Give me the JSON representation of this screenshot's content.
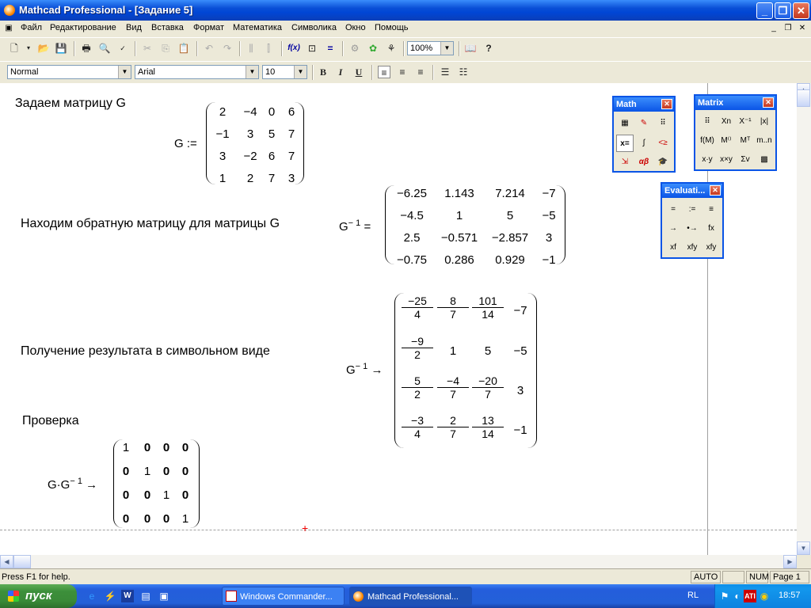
{
  "window": {
    "title": "Mathcad Professional - [Задание 5]"
  },
  "menu": [
    "Файл",
    "Редактирование",
    "Вид",
    "Вставка",
    "Формат",
    "Математика",
    "Символика",
    "Окно",
    "Помощь"
  ],
  "toolbar": {
    "zoom": "100%",
    "style": "Normal",
    "font": "Arial",
    "size": "10",
    "bold": "B",
    "italic": "I",
    "underline": "U"
  },
  "doc": {
    "label1": "Задаем матрицу G",
    "label2": "Находим обратную матрицу для матрицы G",
    "label3": "Получение результата в символьном виде",
    "label4": "Проверка",
    "def_lhs": "G :=",
    "inv_lhs": "G",
    "inv_sup": "− 1",
    "inv_eq": "=",
    "sym_lhs": "G",
    "sym_sup": "− 1",
    "sym_arrow": "→",
    "chk_lhs": "G·G",
    "chk_sup": "− 1",
    "chk_arrow": "→",
    "G": [
      [
        "2",
        "−4",
        "0",
        "6"
      ],
      [
        "−1",
        "3",
        "5",
        "7"
      ],
      [
        "3",
        "−2",
        "6",
        "7"
      ],
      [
        "1",
        "2",
        "7",
        "3"
      ]
    ],
    "Ginv": [
      [
        "−6.25",
        "1.143",
        "7.214",
        "−7"
      ],
      [
        "−4.5",
        "1",
        "5",
        "−5"
      ],
      [
        "2.5",
        "−0.571",
        "−2.857",
        "3"
      ],
      [
        "−0.75",
        "0.286",
        "0.929",
        "−1"
      ]
    ],
    "Gsym": [
      [
        {
          "n": "−25",
          "d": "4"
        },
        {
          "n": "8",
          "d": "7"
        },
        {
          "n": "101",
          "d": "14"
        },
        {
          "v": "−7"
        }
      ],
      [
        {
          "n": "−9",
          "d": "2"
        },
        {
          "v": "1"
        },
        {
          "v": "5"
        },
        {
          "v": "−5"
        }
      ],
      [
        {
          "n": "5",
          "d": "2"
        },
        {
          "n": "−4",
          "d": "7"
        },
        {
          "n": "−20",
          "d": "7"
        },
        {
          "v": "3"
        }
      ],
      [
        {
          "n": "−3",
          "d": "4"
        },
        {
          "n": "2",
          "d": "7"
        },
        {
          "n": "13",
          "d": "14"
        },
        {
          "v": "−1"
        }
      ]
    ],
    "I": [
      [
        "1",
        "0",
        "0",
        "0"
      ],
      [
        "0",
        "1",
        "0",
        "0"
      ],
      [
        "0",
        "0",
        "1",
        "0"
      ],
      [
        "0",
        "0",
        "0",
        "1"
      ]
    ]
  },
  "palettes": {
    "math": {
      "title": "Math"
    },
    "matrix": {
      "title": "Matrix"
    },
    "evaluation": {
      "title": "Evaluati...",
      "buttons": [
        "=",
        ":=",
        "≡",
        "→",
        "•→",
        "fx",
        "xf",
        "xfy",
        "xfy"
      ]
    }
  },
  "status": {
    "help": "Press F1 for help.",
    "mode": "AUTO",
    "num": "NUM",
    "page": "Page 1"
  },
  "taskbar": {
    "start": "пуск",
    "task1": "Windows Commander...",
    "task2": "Mathcad Professional...",
    "lang": "RL",
    "clock": "18:57"
  }
}
